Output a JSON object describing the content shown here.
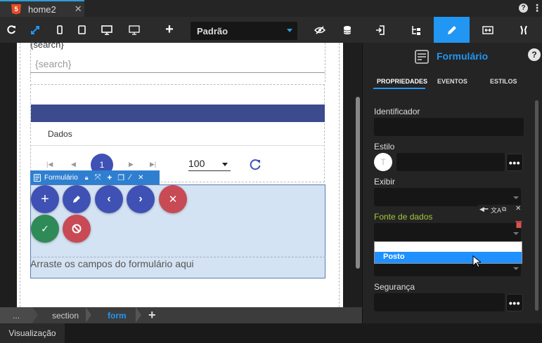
{
  "tab": {
    "title": "home2",
    "close": "✕"
  },
  "window": {
    "help": "?",
    "menu": "⋮"
  },
  "toolbar": {
    "device_select": "Padrão"
  },
  "canvas": {
    "search_label": "{search}",
    "search_placeholder": "{search}",
    "grid_row_text": "Dados",
    "page_current": "1",
    "page_size": "100",
    "form_tag": "Formulário",
    "drop_hint": "Arraste os campos do formulário aqui"
  },
  "right": {
    "title": "Formulário",
    "help": "?",
    "tabs": [
      "PROPRIEDADES",
      "EVENTOS",
      "ESTILOS"
    ],
    "fields": {
      "identificador": "Identificador",
      "estilo": "Estilo",
      "estilo_avatar": "T",
      "exibir": "Exibir",
      "fonte": "Fonte de dados",
      "seguranca": "Segurança"
    },
    "dropdown_options": [
      "",
      "Posto"
    ],
    "dots": "•••"
  },
  "breadcrumb": [
    "...",
    "section",
    "form"
  ],
  "breadcrumb_add": "+",
  "status": {
    "label": "Visualização"
  },
  "colors": {
    "accent": "#2196f3",
    "fonte_label": "#a4c639",
    "danger": "#c84a54",
    "success": "#2e8b57",
    "primary": "#3f51b5",
    "grid_header": "#3c4a8e"
  }
}
